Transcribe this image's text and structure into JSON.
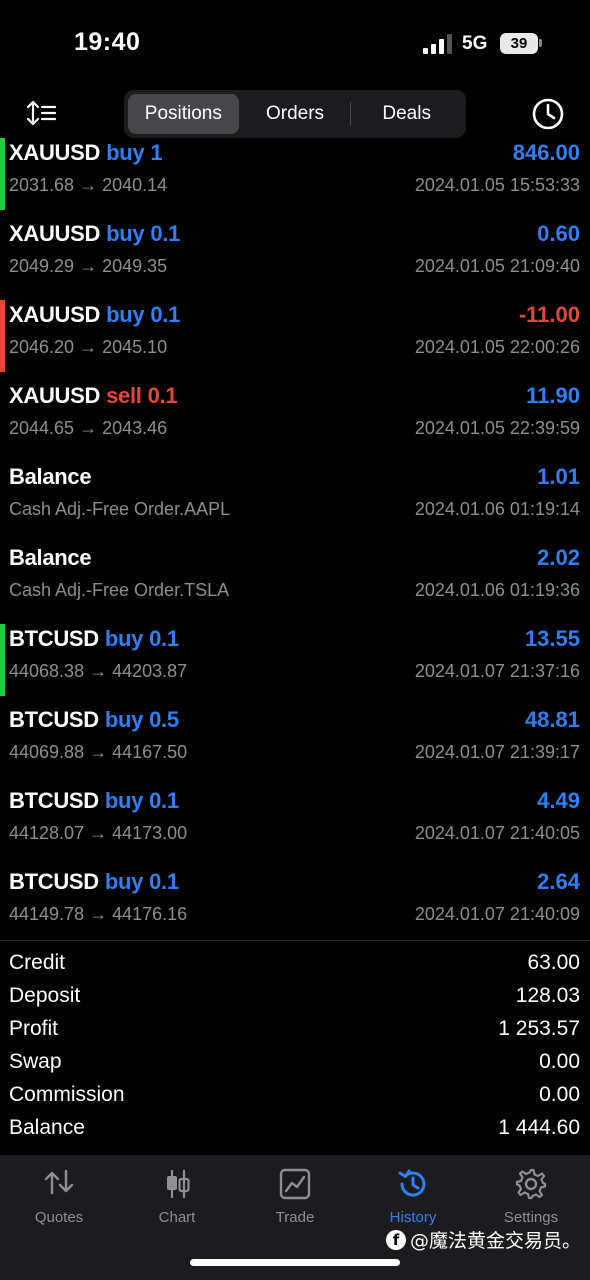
{
  "status_bar": {
    "time": "19:40",
    "network": "5G",
    "battery": "39"
  },
  "segments": [
    {
      "label": "Positions",
      "active": true
    },
    {
      "label": "Orders",
      "active": false
    },
    {
      "label": "Deals",
      "active": false
    }
  ],
  "colors": {
    "buy": "#2f7ff5",
    "sell": "#e5483a",
    "profit": "#2f7ff5",
    "loss": "#e5483a",
    "bar_green": "#27c93f",
    "bar_red": "#e5483a",
    "accent": "#2f7ff5"
  },
  "deals": [
    {
      "symbol": "XAUUSD",
      "side": "buy",
      "volume": "1",
      "side_type": "buy",
      "prices": "2031.68 → 2040.14",
      "value": "846.00",
      "value_type": "profit",
      "time": "2024.01.05 15:53:33",
      "bar": "green"
    },
    {
      "symbol": "XAUUSD",
      "side": "buy",
      "volume": "0.1",
      "side_type": "buy",
      "prices": "2049.29 → 2049.35",
      "value": "0.60",
      "value_type": "profit",
      "time": "2024.01.05 21:09:40",
      "bar": "none"
    },
    {
      "symbol": "XAUUSD",
      "side": "buy",
      "volume": "0.1",
      "side_type": "buy",
      "prices": "2046.20 → 2045.10",
      "value": "-11.00",
      "value_type": "loss",
      "time": "2024.01.05 22:00:26",
      "bar": "red"
    },
    {
      "symbol": "XAUUSD",
      "side": "sell",
      "volume": "0.1",
      "side_type": "sell",
      "prices": "2044.65 → 2043.46",
      "value": "11.90",
      "value_type": "profit",
      "time": "2024.01.05 22:39:59",
      "bar": "none"
    },
    {
      "symbol": "Balance",
      "side": "",
      "volume": "",
      "side_type": "none",
      "prices": "Cash Adj.-Free Order.AAPL",
      "value": "1.01",
      "value_type": "profit",
      "time": "2024.01.06 01:19:14",
      "bar": "none"
    },
    {
      "symbol": "Balance",
      "side": "",
      "volume": "",
      "side_type": "none",
      "prices": "Cash Adj.-Free Order.TSLA",
      "value": "2.02",
      "value_type": "profit",
      "time": "2024.01.06 01:19:36",
      "bar": "none"
    },
    {
      "symbol": "BTCUSD",
      "side": "buy",
      "volume": "0.1",
      "side_type": "buy",
      "prices": "44068.38 → 44203.87",
      "value": "13.55",
      "value_type": "profit",
      "time": "2024.01.07 21:37:16",
      "bar": "green"
    },
    {
      "symbol": "BTCUSD",
      "side": "buy",
      "volume": "0.5",
      "side_type": "buy",
      "prices": "44069.88 → 44167.50",
      "value": "48.81",
      "value_type": "profit",
      "time": "2024.01.07 21:39:17",
      "bar": "none"
    },
    {
      "symbol": "BTCUSD",
      "side": "buy",
      "volume": "0.1",
      "side_type": "buy",
      "prices": "44128.07 → 44173.00",
      "value": "4.49",
      "value_type": "profit",
      "time": "2024.01.07 21:40:05",
      "bar": "none"
    },
    {
      "symbol": "BTCUSD",
      "side": "buy",
      "volume": "0.1",
      "side_type": "buy",
      "prices": "44149.78 → 44176.16",
      "value": "2.64",
      "value_type": "profit",
      "time": "2024.01.07 21:40:09",
      "bar": "none"
    }
  ],
  "summary": [
    {
      "label": "Credit",
      "value": "63.00"
    },
    {
      "label": "Deposit",
      "value": "128.03"
    },
    {
      "label": "Profit",
      "value": "1 253.57"
    },
    {
      "label": "Swap",
      "value": "0.00"
    },
    {
      "label": "Commission",
      "value": "0.00"
    },
    {
      "label": "Balance",
      "value": "1 444.60"
    }
  ],
  "tabs": [
    {
      "label": "Quotes",
      "icon": "quotes-icon",
      "active": false
    },
    {
      "label": "Chart",
      "icon": "chart-icon",
      "active": false
    },
    {
      "label": "Trade",
      "icon": "trade-icon",
      "active": false
    },
    {
      "label": "History",
      "icon": "history-icon",
      "active": true
    },
    {
      "label": "Settings",
      "icon": "settings-icon",
      "active": false
    }
  ],
  "watermark": "@魔法黄金交易员。"
}
